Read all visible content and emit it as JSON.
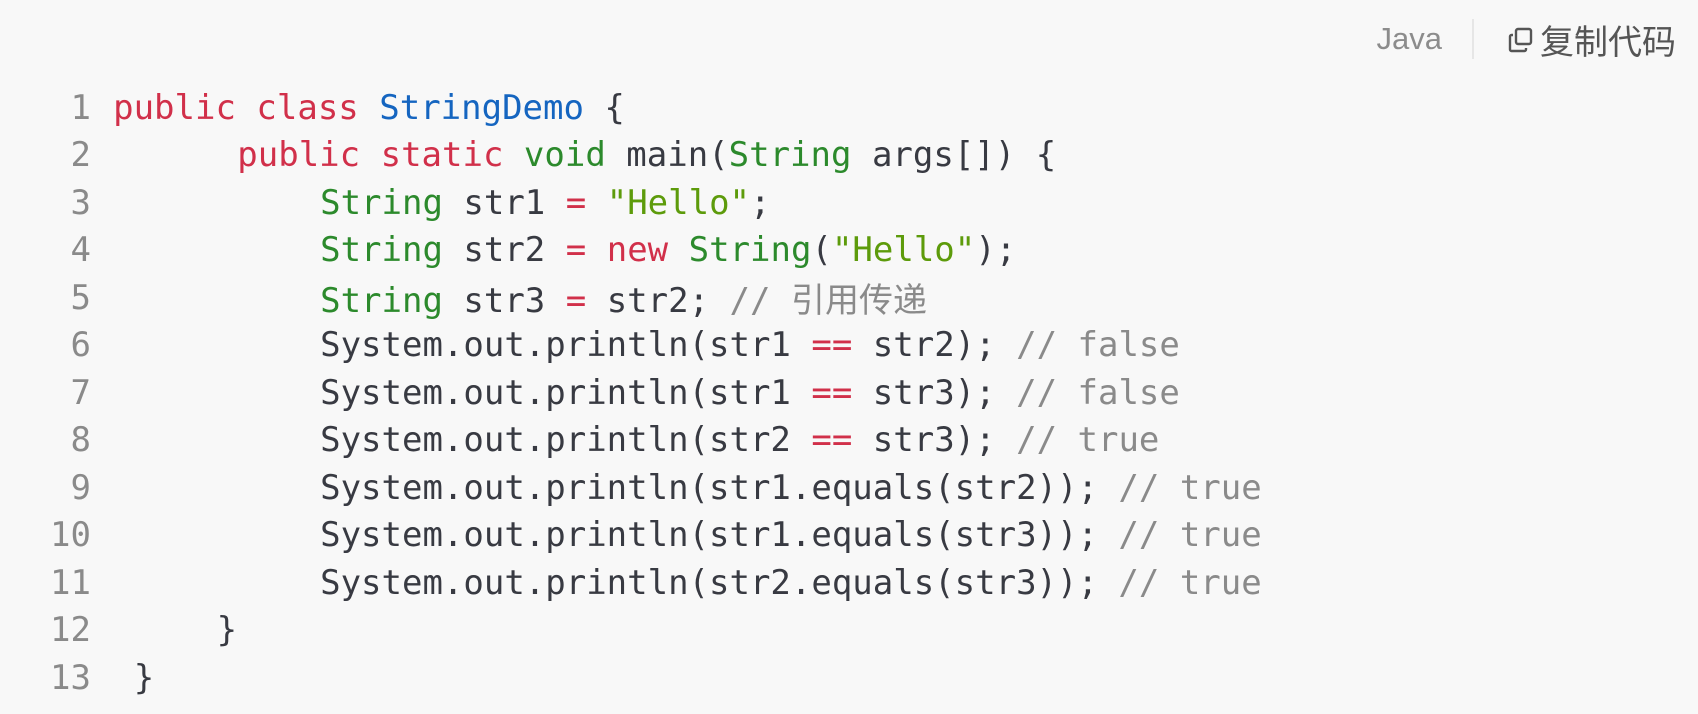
{
  "toolbar": {
    "language": "Java",
    "copy_label": "复制代码",
    "copy_icon": "copy-icon"
  },
  "colors": {
    "background": "#f8f8f8",
    "keyword": "#d1304a",
    "type": "#2c8a2c",
    "class_name": "#1565c0",
    "string": "#5d9b0b",
    "operator": "#d1304a",
    "comment": "#8a8a8a",
    "line_number": "#8a8a8a",
    "plain": "#383a42"
  },
  "code_lines": [
    {
      "number": "1",
      "indent": 3,
      "tokens": [
        {
          "t": "kw",
          "v": "public"
        },
        {
          "t": "plain",
          "v": " "
        },
        {
          "t": "kw",
          "v": "class"
        },
        {
          "t": "plain",
          "v": " "
        },
        {
          "t": "cls",
          "v": "StringDemo"
        },
        {
          "t": "plain",
          "v": " {"
        }
      ]
    },
    {
      "number": "2",
      "indent": 9,
      "tokens": [
        {
          "t": "kw",
          "v": "public"
        },
        {
          "t": "plain",
          "v": " "
        },
        {
          "t": "kw",
          "v": "static"
        },
        {
          "t": "plain",
          "v": " "
        },
        {
          "t": "type",
          "v": "void"
        },
        {
          "t": "plain",
          "v": " main("
        },
        {
          "t": "type",
          "v": "String"
        },
        {
          "t": "plain",
          "v": " args[]) {"
        }
      ]
    },
    {
      "number": "3",
      "indent": 13,
      "tokens": [
        {
          "t": "type",
          "v": "String"
        },
        {
          "t": "plain",
          "v": " str1 "
        },
        {
          "t": "op",
          "v": "="
        },
        {
          "t": "plain",
          "v": " "
        },
        {
          "t": "str",
          "v": "\"Hello\""
        },
        {
          "t": "plain",
          "v": ";"
        }
      ]
    },
    {
      "number": "4",
      "indent": 13,
      "tokens": [
        {
          "t": "type",
          "v": "String"
        },
        {
          "t": "plain",
          "v": " str2 "
        },
        {
          "t": "op",
          "v": "="
        },
        {
          "t": "plain",
          "v": " "
        },
        {
          "t": "kw",
          "v": "new"
        },
        {
          "t": "plain",
          "v": " "
        },
        {
          "t": "type",
          "v": "String"
        },
        {
          "t": "plain",
          "v": "("
        },
        {
          "t": "str",
          "v": "\"Hello\""
        },
        {
          "t": "plain",
          "v": ");"
        }
      ]
    },
    {
      "number": "5",
      "indent": 13,
      "tokens": [
        {
          "t": "type",
          "v": "String"
        },
        {
          "t": "plain",
          "v": " str3 "
        },
        {
          "t": "op",
          "v": "="
        },
        {
          "t": "plain",
          "v": " str2; "
        },
        {
          "t": "cm",
          "v": "// 引用传递"
        }
      ]
    },
    {
      "number": "6",
      "indent": 13,
      "tokens": [
        {
          "t": "plain",
          "v": "System.out.println(str1 "
        },
        {
          "t": "op",
          "v": "=="
        },
        {
          "t": "plain",
          "v": " str2); "
        },
        {
          "t": "cm",
          "v": "// false"
        }
      ]
    },
    {
      "number": "7",
      "indent": 13,
      "tokens": [
        {
          "t": "plain",
          "v": "System.out.println(str1 "
        },
        {
          "t": "op",
          "v": "=="
        },
        {
          "t": "plain",
          "v": " str3); "
        },
        {
          "t": "cm",
          "v": "// false"
        }
      ]
    },
    {
      "number": "8",
      "indent": 13,
      "tokens": [
        {
          "t": "plain",
          "v": "System.out.println(str2 "
        },
        {
          "t": "op",
          "v": "=="
        },
        {
          "t": "plain",
          "v": " str3); "
        },
        {
          "t": "cm",
          "v": "// true"
        }
      ]
    },
    {
      "number": "9",
      "indent": 13,
      "tokens": [
        {
          "t": "plain",
          "v": "System.out.println(str1.equals(str2)); "
        },
        {
          "t": "cm",
          "v": "// true"
        }
      ]
    },
    {
      "number": "10",
      "indent": 13,
      "tokens": [
        {
          "t": "plain",
          "v": "System.out.println(str1.equals(str3)); "
        },
        {
          "t": "cm",
          "v": "// true"
        }
      ]
    },
    {
      "number": "11",
      "indent": 13,
      "tokens": [
        {
          "t": "plain",
          "v": "System.out.println(str2.equals(str3)); "
        },
        {
          "t": "cm",
          "v": "// true"
        }
      ]
    },
    {
      "number": "12",
      "indent": 8,
      "tokens": [
        {
          "t": "plain",
          "v": "}"
        }
      ]
    },
    {
      "number": "13",
      "indent": 4,
      "tokens": [
        {
          "t": "plain",
          "v": "}"
        }
      ]
    }
  ]
}
